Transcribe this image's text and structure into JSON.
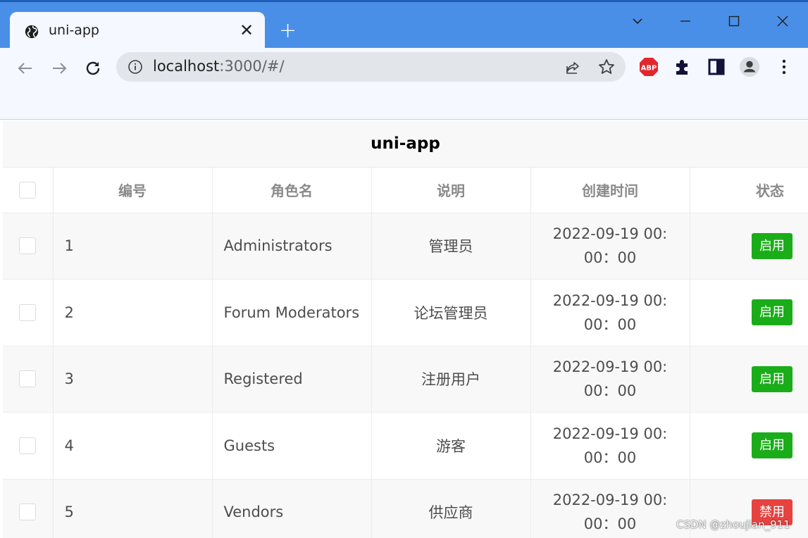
{
  "browser": {
    "tab_title": "uni-app",
    "new_tab_symbol": "+",
    "close_tab_symbol": "✕",
    "url_host": "localhost",
    "url_rest": ":3000/#/",
    "extensions": {
      "abp_label": "ABP"
    },
    "icons": [
      "globe-icon",
      "back-icon",
      "forward-icon",
      "reload-icon",
      "info-icon",
      "share-icon",
      "star-icon",
      "adblock-icon",
      "puzzle-icon",
      "sidepanel-icon",
      "profile-icon",
      "kebab-menu-icon",
      "chevron-down-icon",
      "minimize-icon",
      "maximize-icon",
      "close-window-icon"
    ]
  },
  "page": {
    "title": "uni-app"
  },
  "table": {
    "headers": {
      "id": "编号",
      "name": "角色名",
      "desc": "说明",
      "created": "创建时间",
      "status": "状态"
    },
    "rows": [
      {
        "id": "1",
        "name": "Administrators",
        "desc": "管理员",
        "time1": "2022-09-19 00:",
        "time2": "00：00",
        "status": "启用"
      },
      {
        "id": "2",
        "name": "Forum Moderators",
        "desc": "论坛管理员",
        "time1": "2022-09-19 00:",
        "time2": "00：00",
        "status": "启用"
      },
      {
        "id": "3",
        "name": "Registered",
        "desc": "注册用户",
        "time1": "2022-09-19 00:",
        "time2": "00：00",
        "status": "启用"
      },
      {
        "id": "4",
        "name": "Guests",
        "desc": "游客",
        "time1": "2022-09-19 00:",
        "time2": "00：00",
        "status": "启用"
      },
      {
        "id": "5",
        "name": "Vendors",
        "desc": "供应商",
        "time1": "2022-09-19 00:",
        "time2": "00：00",
        "status": "禁用"
      }
    ]
  },
  "colors": {
    "chrome_blue": "#4a8fe7",
    "enabled_green": "#1aad19",
    "disabled_red": "#e64340",
    "header_gray": "#8a8a8a"
  },
  "watermark": "CSDN @zhoujian_911"
}
